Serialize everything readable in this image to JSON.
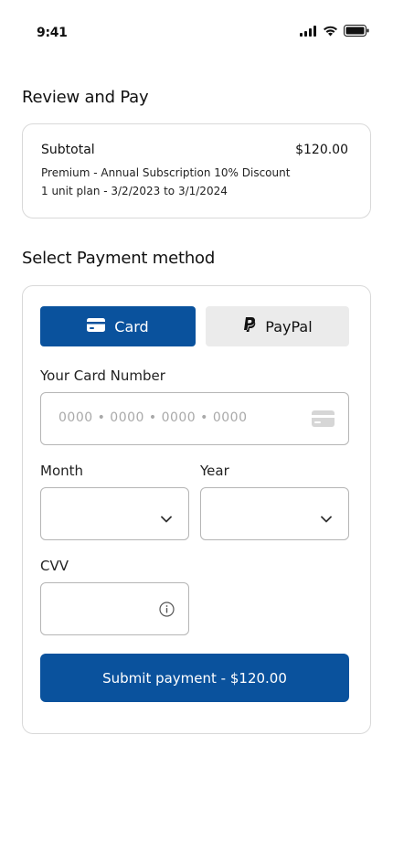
{
  "status_bar": {
    "time": "9:41",
    "icons": [
      "signal-icon",
      "wifi-icon",
      "battery-icon"
    ]
  },
  "review": {
    "title": "Review and Pay",
    "subtotal_label": "Subtotal",
    "subtotal_value": "$120.00",
    "plan_description": "Premium - Annual Subscription 10% Discount",
    "plan_period": "1 unit plan - 3/2/2023 to 3/1/2024"
  },
  "payment": {
    "title": "Select Payment method",
    "tabs": [
      {
        "label": "Card",
        "icon": "card-icon",
        "selected": true
      },
      {
        "label": "PayPal",
        "icon": "paypal-icon",
        "selected": false
      }
    ],
    "card_number": {
      "label": "Your Card Number",
      "placeholder": "0000 • 0000 • 0000 • 0000",
      "value": ""
    },
    "month": {
      "label": "Month",
      "value": ""
    },
    "year": {
      "label": "Year",
      "value": ""
    },
    "cvv": {
      "label": "CVV",
      "value": ""
    },
    "submit_label": "Submit payment - $120.00"
  },
  "colors": {
    "primary": "#0a529d",
    "secondary_tab": "#ebebeb",
    "border": "#d9d9d9",
    "input_border": "#b5b5b5",
    "placeholder": "#a9a9a9"
  }
}
